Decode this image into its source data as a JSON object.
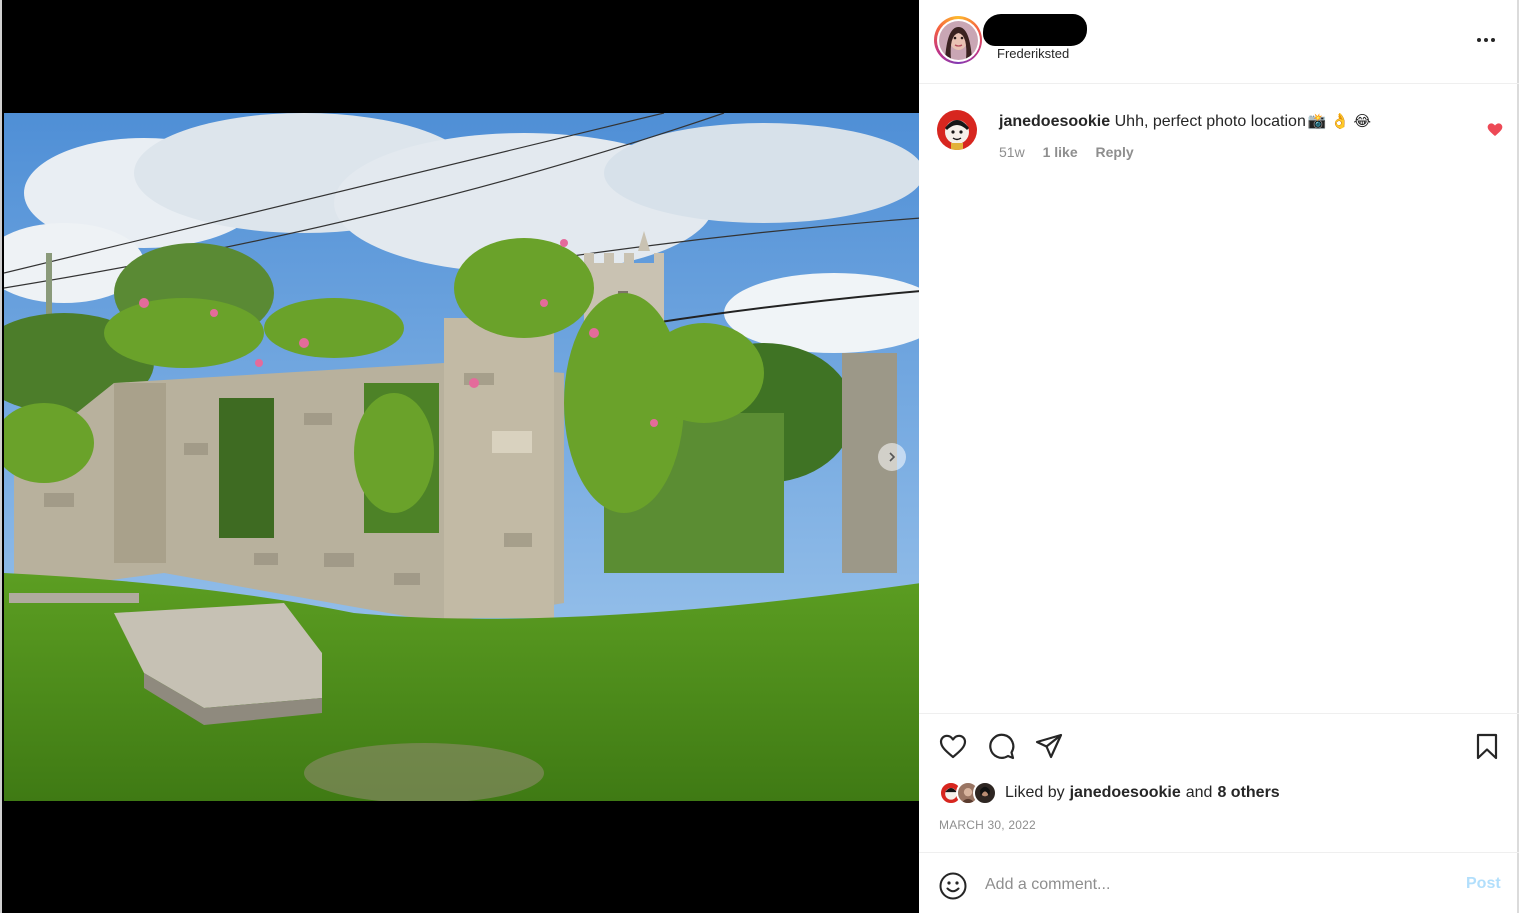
{
  "post": {
    "location": "Frederiksted",
    "more_icon": "more-horizontal-icon"
  },
  "comment": {
    "username": "janedoesookie",
    "text": "Uhh, perfect photo location",
    "emojis": "📸 👌 😂",
    "age": "51w",
    "likes": "1 like",
    "reply": "Reply",
    "liked": true,
    "heart_color": "#ed4956"
  },
  "actions": {
    "icons": [
      "heart-icon",
      "comment-icon",
      "share-icon",
      "bookmark-icon"
    ]
  },
  "likes": {
    "prefix": "Liked by",
    "user": "janedoesookie",
    "conjunction": "and",
    "others": "8 others"
  },
  "date": "MARCH 30, 2022",
  "add_comment": {
    "placeholder": "Add a comment...",
    "post_label": "Post",
    "post_color": "#b2dffc"
  },
  "colors": {
    "text": "#262626",
    "secondary": "#8e8e8e",
    "divider": "#efefef"
  }
}
